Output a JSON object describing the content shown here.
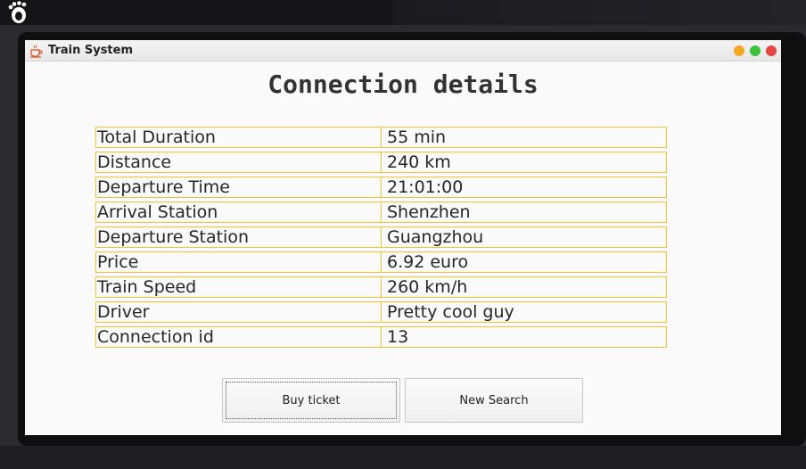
{
  "window": {
    "title": "Train System"
  },
  "heading": "Connection details",
  "details": [
    {
      "label": "Total Duration",
      "value": "55 min"
    },
    {
      "label": "Distance",
      "value": "240 km"
    },
    {
      "label": "Departure Time",
      "value": "21:01:00"
    },
    {
      "label": "Arrival Station",
      "value": "Shenzhen"
    },
    {
      "label": "Departure Station",
      "value": "Guangzhou"
    },
    {
      "label": "Price",
      "value": "6.92 euro"
    },
    {
      "label": "Train Speed",
      "value": "260 km/h"
    },
    {
      "label": "Driver",
      "value": "Pretty cool guy"
    },
    {
      "label": "Connection id",
      "value": "13"
    }
  ],
  "buttons": {
    "buy_label": "Buy ticket",
    "new_search_label": "New Search"
  },
  "colors": {
    "cell_border": "#f2c230",
    "minimize": "#f5a623",
    "maximize": "#3cc23c",
    "close": "#e84545"
  },
  "icons": {
    "desktop_logo": "gnome-foot-icon",
    "app_icon": "java-cup-icon"
  }
}
